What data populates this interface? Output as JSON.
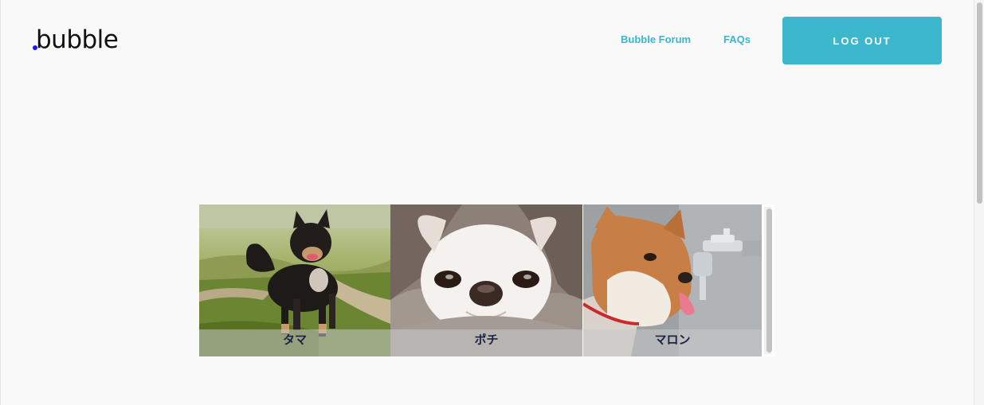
{
  "header": {
    "logo_text": "bubble",
    "nav": {
      "forum_label": "Bubble Forum",
      "faqs_label": "FAQs"
    },
    "logout_label": "LOG OUT"
  },
  "gallery": {
    "items": [
      {
        "caption": "タマ",
        "image": "black-tan-shiba-dog-on-grass-path-photo"
      },
      {
        "caption": "ポチ",
        "image": "white-chihuahua-in-blanket-photo"
      },
      {
        "caption": "マロン",
        "image": "shiba-dog-drinking-from-faucet-photo"
      }
    ]
  },
  "colors": {
    "accent": "#3cb7cb",
    "logo_dot": "#1d1ae6",
    "caption_text": "#1d2247",
    "background": "#f9f9f9"
  }
}
